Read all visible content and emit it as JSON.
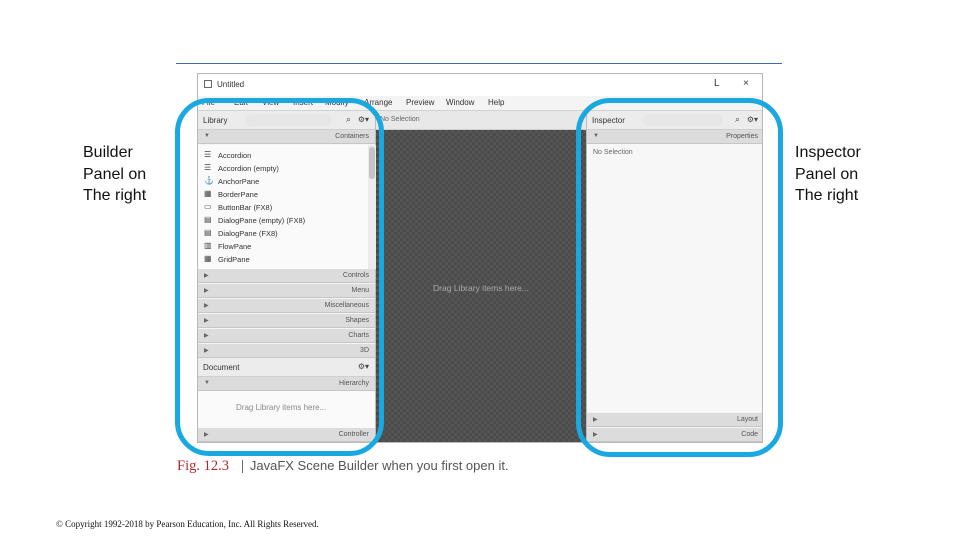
{
  "annotations": {
    "left_label": "Builder\nPanel on\nThe right",
    "right_label": "Inspector\nPanel on\nThe right",
    "ring_color": "#1aa8e0"
  },
  "window": {
    "title": "Untitled",
    "minimize_glyph": "L",
    "close_glyph": "×",
    "app_icon": "window-icon"
  },
  "menubar": {
    "items": [
      "File",
      "Edit",
      "View",
      "Insert",
      "Modify",
      "Arrange",
      "Preview",
      "Window",
      "Help"
    ]
  },
  "library": {
    "header": "Library",
    "search_icon": "magnifier-icon",
    "settings_icon": "gear-dropdown-icon",
    "containers_section": "Containers",
    "items": [
      {
        "label": "Accordion",
        "icon": "accordion-icon"
      },
      {
        "label": "Accordion  (empty)",
        "icon": "accordion-icon"
      },
      {
        "label": "AnchorPane",
        "icon": "anchorpane-icon"
      },
      {
        "label": "BorderPane",
        "icon": "borderpane-icon"
      },
      {
        "label": "ButtonBar  (FX8)",
        "icon": "buttonbar-icon"
      },
      {
        "label": "DialogPane (empty)  (FX8)",
        "icon": "dialogpane-icon"
      },
      {
        "label": "DialogPane  (FX8)",
        "icon": "dialogpane-icon"
      },
      {
        "label": "FlowPane",
        "icon": "flowpane-icon"
      },
      {
        "label": "GridPane",
        "icon": "gridpane-icon"
      }
    ],
    "sections": [
      "Controls",
      "Menu",
      "Miscellaneous",
      "Shapes",
      "Charts",
      "3D"
    ]
  },
  "document": {
    "header": "Document",
    "settings_icon": "gear-dropdown-icon",
    "hierarchy_section": "Hierarchy",
    "empty_text": "Drag Library items here...",
    "controller_section": "Controller"
  },
  "canvas": {
    "selection_text": "No Selection",
    "placeholder": "Drag Library items here..."
  },
  "inspector": {
    "header": "Inspector",
    "search_icon": "magnifier-icon",
    "settings_icon": "gear-dropdown-icon",
    "properties_section": "Properties",
    "empty_text": "No Selection",
    "layout_section": "Layout",
    "code_section": "Code"
  },
  "caption": {
    "fig": "Fig. 12.3",
    "separator": "|",
    "text": "JavaFX Scene Builder when you first open it."
  },
  "copyright": "© Copyright 1992-2018 by Pearson Education, Inc. All Rights Reserved."
}
